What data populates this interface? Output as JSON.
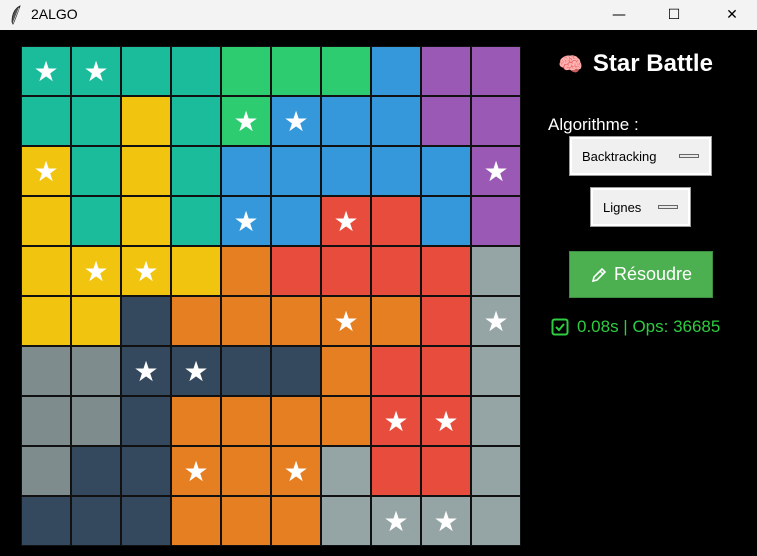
{
  "window": {
    "title": "2ALGO",
    "minimize_glyph": "—",
    "maximize_glyph": "☐",
    "close_glyph": "✕"
  },
  "app": {
    "title": "Star Battle",
    "title_icon": "brain-icon",
    "algorithm_label": "Algorithme :",
    "algorithm_value": "Backtracking",
    "order_value": "Lignes",
    "solve_button": "Résoudre",
    "solve_icon": "pencil-icon",
    "status": "0.08s | Ops: 36685",
    "status_icon": "check-box-icon",
    "status_color": "#2ecc40",
    "solve_color": "#4caf50"
  },
  "colors": {
    "T": "#1abc9c",
    "G": "#2ecc71",
    "B": "#3498db",
    "P": "#9b59b6",
    "Y": "#f1c40f",
    "O": "#e67e22",
    "R": "#e74c3c",
    "L": "#95a5a6",
    "D": "#34495e",
    "S": "#7f8c8d"
  },
  "grid": {
    "size": 10,
    "star_glyph": "★",
    "regions": [
      "TTTTGGGBPP",
      "TTYTGBBBPP",
      "YTYTBBBBBP",
      "YTYTBBRRBP",
      "YYYYORRRRL",
      "YYDOOOOORL",
      "SSDDDDORRL",
      "SSDOOOORRL",
      "SDDOOOLRRL",
      "DDDOOOLLLL"
    ],
    "stars": [
      "**........",
      "....**....",
      "*........*",
      "....*.*...",
      ".**.......",
      "......*..*",
      "..**......",
      ".......**.",
      "...*.*....",
      ".......**."
    ]
  }
}
